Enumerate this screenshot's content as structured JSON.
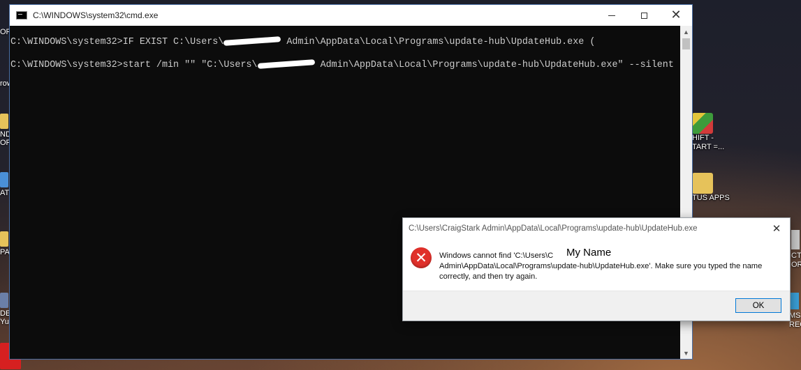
{
  "cmd": {
    "title": "C:\\WINDOWS\\system32\\cmd.exe",
    "line1": {
      "prompt_prefix": "C:\\WINDOWS\\system32>IF EXIST C:\\Users\\",
      "suffix": " Admin\\AppData\\Local\\Programs\\update-hub\\UpdateHub.exe ("
    },
    "line2": {
      "prompt_prefix": "C:\\WINDOWS\\system32>start /min \"\" \"C:\\Users\\",
      "suffix": " Admin\\AppData\\Local\\Programs\\update-hub\\UpdateHub.exe\" --silent"
    }
  },
  "dialog": {
    "title": "C:\\Users\\CraigStark Admin\\AppData\\Local\\Programs\\update-hub\\UpdateHub.exe",
    "message_start": "Windows cannot find 'C:\\Users\\C",
    "message_rest": "Admin\\AppData\\Local\\Programs\\update-hub\\UpdateHub.exe'. Make sure you typed the name correctly, and then try again.",
    "name_overlay": "My Name",
    "ok_label": "OK",
    "error_symbol": "✕",
    "close_symbol": "✕"
  },
  "desktop": {
    "right_icons": [
      {
        "label_line1": "HIFT -",
        "label_line2": "TART =..."
      },
      {
        "label_line1": "TUS APPS",
        "label_line2": ""
      }
    ],
    "left_partial": [
      "ORT",
      "row",
      "ND",
      "OF",
      "AT",
      "PAS",
      "DE",
      "Yu"
    ],
    "far_right_partial": [
      "CT",
      "OR",
      "MS",
      "REC"
    ]
  },
  "colors": {
    "console_bg": "#0c0c0c",
    "console_text": "#cccccc",
    "error_red": "#e0302a",
    "accent_blue": "#0078d7"
  }
}
